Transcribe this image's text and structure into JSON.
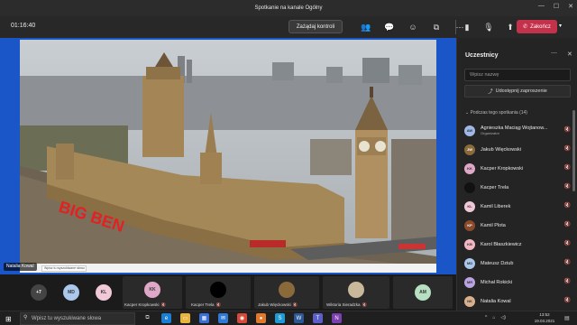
{
  "window": {
    "title": "Spotkanie na kanale Ogólny"
  },
  "toolbar": {
    "timer": "01:16:40",
    "request_control": "Zażądaj kontroli",
    "leave": "Zakończ"
  },
  "share": {
    "overlay_text": "BIG BEN",
    "presenter_tag": "Natalia Kowal",
    "inner_search": "Wpisz tu wyszukiwane słowo"
  },
  "panel": {
    "title": "Uczestnicy",
    "search_placeholder": "Wpisz nazwę",
    "share_invite": "Udostępnij zaproszenie",
    "section": "Podczas tego spotkania (14)",
    "participants": [
      {
        "name": "Agnieszka Maciąg Wojtanow...",
        "role": "Organizator",
        "initials": "AW",
        "color": "#9fb8e8"
      },
      {
        "name": "Jakub Więckowski",
        "role": "",
        "initials": "JW",
        "color": "#8a6a3a"
      },
      {
        "name": "Kacper Kropkowski",
        "role": "",
        "initials": "KK",
        "color": "#e0a8c8"
      },
      {
        "name": "Kacper Trela",
        "role": "",
        "initials": "",
        "color": "#111111"
      },
      {
        "name": "Kamil Liberek",
        "role": "",
        "initials": "KL",
        "color": "#f0c8d8"
      },
      {
        "name": "Kamil Plota",
        "role": "",
        "initials": "KP",
        "color": "#8b4a2b"
      },
      {
        "name": "Karol Błaszkiewicz",
        "role": "",
        "initials": "KB",
        "color": "#f2b8c2"
      },
      {
        "name": "Mateusz Dziub",
        "role": "",
        "initials": "MD",
        "color": "#a9c8ec"
      },
      {
        "name": "Michał Rokicki",
        "role": "",
        "initials": "MR",
        "color": "#b9a3e0"
      },
      {
        "name": "Natalia Kowal",
        "role": "",
        "initials": "NK",
        "color": "#d9b08c"
      }
    ]
  },
  "gallery": {
    "more": "+7",
    "tiles": [
      {
        "initials": "MD",
        "color": "#a9c8ec"
      },
      {
        "initials": "KL",
        "color": "#f0c8d8"
      },
      {
        "name": "Kacper Kropkowski",
        "initials": "KK",
        "color": "#e0a8c8"
      },
      {
        "name": "Kacper Trela",
        "initials": "",
        "color": "#000000"
      },
      {
        "name": "Jakub Więckowski",
        "initials": "",
        "color": "#8a6a3a"
      },
      {
        "name": "Wiktoria Sieradzka",
        "initials": "",
        "color": "#c9b89a"
      },
      {
        "initials": "AM",
        "color": "#b7e0c2"
      }
    ]
  },
  "taskbar": {
    "search_placeholder": "Wpisz tu wyszukiwane słowa",
    "time": "13:52",
    "date": "19.03.2021"
  }
}
